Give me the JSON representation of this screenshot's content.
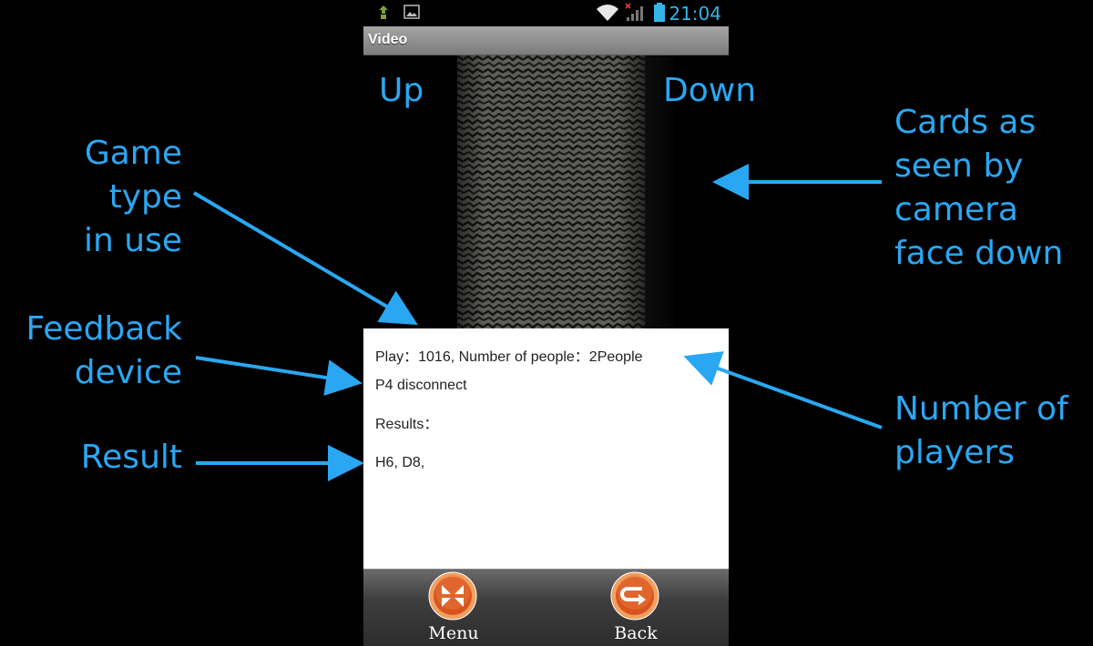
{
  "status_bar": {
    "time": "21:04",
    "icons": [
      "usb-debug-icon",
      "image-notification-icon",
      "wifi-icon",
      "signal-no-service-icon",
      "battery-icon"
    ]
  },
  "app": {
    "title": "Video"
  },
  "info": {
    "play_line": "Play：1016, Number of people：2People",
    "device_line": "P4 disconnect",
    "results_label": "Results：",
    "results_value": "H6, D8,"
  },
  "bottom_bar": {
    "menu_label": "Menu",
    "back_label": "Back"
  },
  "annotations": {
    "up": "Up",
    "down": "Down",
    "game_type": [
      "Game",
      "type",
      "in use"
    ],
    "feedback": [
      "Feedback",
      "device"
    ],
    "result": "Result",
    "cards": [
      "Cards as",
      "seen by",
      "camera",
      "face down"
    ],
    "players": [
      "Number of",
      "players"
    ]
  },
  "colors": {
    "annotation": "#2aa7f2",
    "status_time": "#33b5e5",
    "menu_button": "#e0672a",
    "back_button": "#e0672a"
  }
}
